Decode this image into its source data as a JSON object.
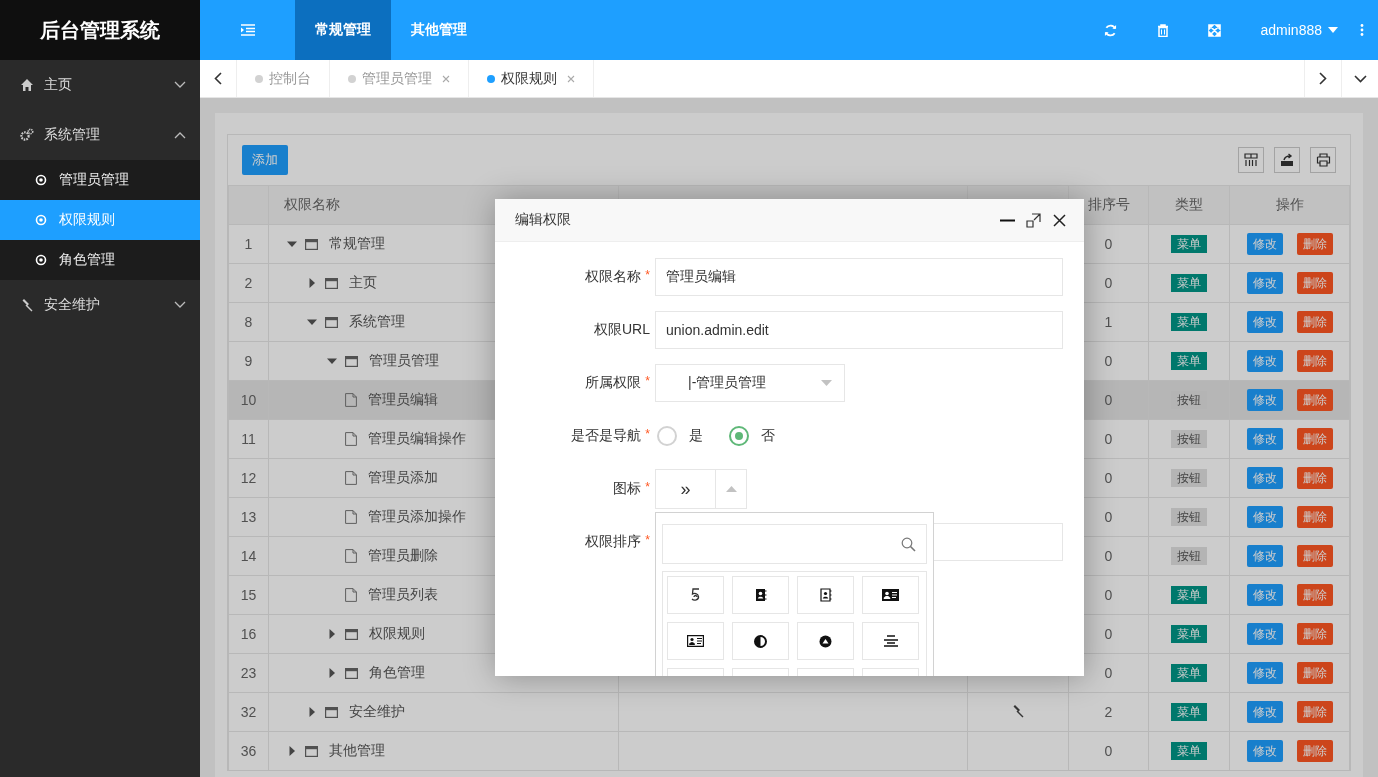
{
  "sidebar": {
    "logo": "后台管理系统",
    "items": [
      {
        "label": "主页",
        "expanded": false
      },
      {
        "label": "系统管理",
        "expanded": true,
        "children": [
          {
            "label": "管理员管理",
            "selected": false
          },
          {
            "label": "权限规则",
            "selected": true
          },
          {
            "label": "角色管理",
            "selected": false
          }
        ]
      },
      {
        "label": "安全维护",
        "expanded": false
      }
    ]
  },
  "header": {
    "nav_tabs": [
      {
        "label": "常规管理",
        "selected": true
      },
      {
        "label": "其他管理",
        "selected": false
      }
    ],
    "user": "admin888"
  },
  "tabs": [
    {
      "label": "控制台",
      "selected": false,
      "closable": false
    },
    {
      "label": "管理员管理",
      "selected": false,
      "closable": true
    },
    {
      "label": "权限规则",
      "selected": true,
      "closable": true
    }
  ],
  "toolbar": {
    "add_button": "添加"
  },
  "table": {
    "columns": {
      "name": "权限名称",
      "sort": "排序号",
      "type": "类型",
      "actions": "操作"
    },
    "rows": [
      {
        "id": "1",
        "name": "常规管理",
        "kind": "folder",
        "expanded": true,
        "sort": "0",
        "type": {
          "label": "菜单",
          "kind": "menu"
        },
        "selected": false,
        "actions": [
          "修改",
          "删除"
        ],
        "children": [
          {
            "id": "2",
            "name": "主页",
            "kind": "folder",
            "expanded": false,
            "sort": "0",
            "type": {
              "label": "菜单",
              "kind": "menu"
            },
            "selected": false,
            "actions": [
              "修改",
              "删除"
            ]
          },
          {
            "id": "8",
            "name": "系统管理",
            "kind": "folder",
            "expanded": true,
            "sort": "1",
            "type": {
              "label": "菜单",
              "kind": "menu"
            },
            "selected": false,
            "actions": [
              "修改",
              "删除"
            ],
            "children": [
              {
                "id": "9",
                "name": "管理员管理",
                "kind": "folder",
                "expanded": true,
                "sort": "0",
                "type": {
                  "label": "菜单",
                  "kind": "menu"
                },
                "selected": false,
                "actions": [
                  "修改",
                  "删除"
                ],
                "children": [
                  {
                    "id": "10",
                    "name": "管理员编辑",
                    "kind": "file",
                    "sort": "0",
                    "type": {
                      "label": "按钮",
                      "kind": "button"
                    },
                    "selected": true,
                    "actions": [
                      "修改",
                      "删除"
                    ]
                  },
                  {
                    "id": "11",
                    "name": "管理员编辑操作",
                    "kind": "file",
                    "sort": "0",
                    "type": {
                      "label": "按钮",
                      "kind": "button"
                    },
                    "selected": false,
                    "actions": [
                      "修改",
                      "删除"
                    ]
                  },
                  {
                    "id": "12",
                    "name": "管理员添加",
                    "kind": "file",
                    "sort": "0",
                    "type": {
                      "label": "按钮",
                      "kind": "button"
                    },
                    "selected": false,
                    "actions": [
                      "修改",
                      "删除"
                    ]
                  },
                  {
                    "id": "13",
                    "name": "管理员添加操作",
                    "kind": "file",
                    "sort": "0",
                    "type": {
                      "label": "按钮",
                      "kind": "button"
                    },
                    "selected": false,
                    "actions": [
                      "修改",
                      "删除"
                    ]
                  },
                  {
                    "id": "14",
                    "name": "管理员删除",
                    "kind": "file",
                    "sort": "0",
                    "type": {
                      "label": "按钮",
                      "kind": "button"
                    },
                    "selected": false,
                    "actions": [
                      "修改",
                      "删除"
                    ]
                  },
                  {
                    "id": "15",
                    "name": "管理员列表",
                    "kind": "file",
                    "sort": "0",
                    "type": {
                      "label": "菜单",
                      "kind": "menu"
                    },
                    "selected": false,
                    "actions": [
                      "修改",
                      "删除"
                    ]
                  }
                ]
              },
              {
                "id": "16",
                "name": "权限规则",
                "kind": "folder",
                "expanded": false,
                "sort": "0",
                "type": {
                  "label": "菜单",
                  "kind": "menu"
                },
                "selected": false,
                "actions": [
                  "修改",
                  "删除"
                ]
              },
              {
                "id": "23",
                "name": "角色管理",
                "kind": "folder",
                "expanded": false,
                "sort": "0",
                "type": {
                  "label": "菜单",
                  "kind": "menu"
                },
                "selected": false,
                "actions": [
                  "修改",
                  "删除"
                ]
              }
            ]
          },
          {
            "id": "32",
            "name": "安全维护",
            "kind": "folder",
            "expanded": false,
            "nav_icon": true,
            "sort": "2",
            "type": {
              "label": "菜单",
              "kind": "menu"
            },
            "selected": false,
            "actions": [
              "修改",
              "删除"
            ]
          }
        ]
      },
      {
        "id": "36",
        "name": "其他管理",
        "kind": "folder",
        "expanded": false,
        "sort": "0",
        "type": {
          "label": "菜单",
          "kind": "menu"
        },
        "selected": false,
        "actions": [
          "修改",
          "删除"
        ]
      }
    ]
  },
  "modal": {
    "title": "编辑权限",
    "fields": [
      {
        "label": "权限名称",
        "mark": "*",
        "kind": "text",
        "value": "管理员编辑"
      },
      {
        "label": "权限URL",
        "kind": "text",
        "value": "union.admin.edit"
      },
      {
        "label": "所属权限",
        "mark": "*",
        "kind": "select",
        "value": "|-管理员管理"
      },
      {
        "label": "是否是导航",
        "mark": "*",
        "kind": "radio",
        "options": [
          {
            "label": "是",
            "selected": false
          },
          {
            "label": "否",
            "selected": true
          }
        ]
      },
      {
        "label": "图标",
        "mark": "*",
        "kind": "icon",
        "value": "»",
        "expanded": true
      },
      {
        "label": "权限排序",
        "mark": "*",
        "kind": "text"
      }
    ]
  }
}
